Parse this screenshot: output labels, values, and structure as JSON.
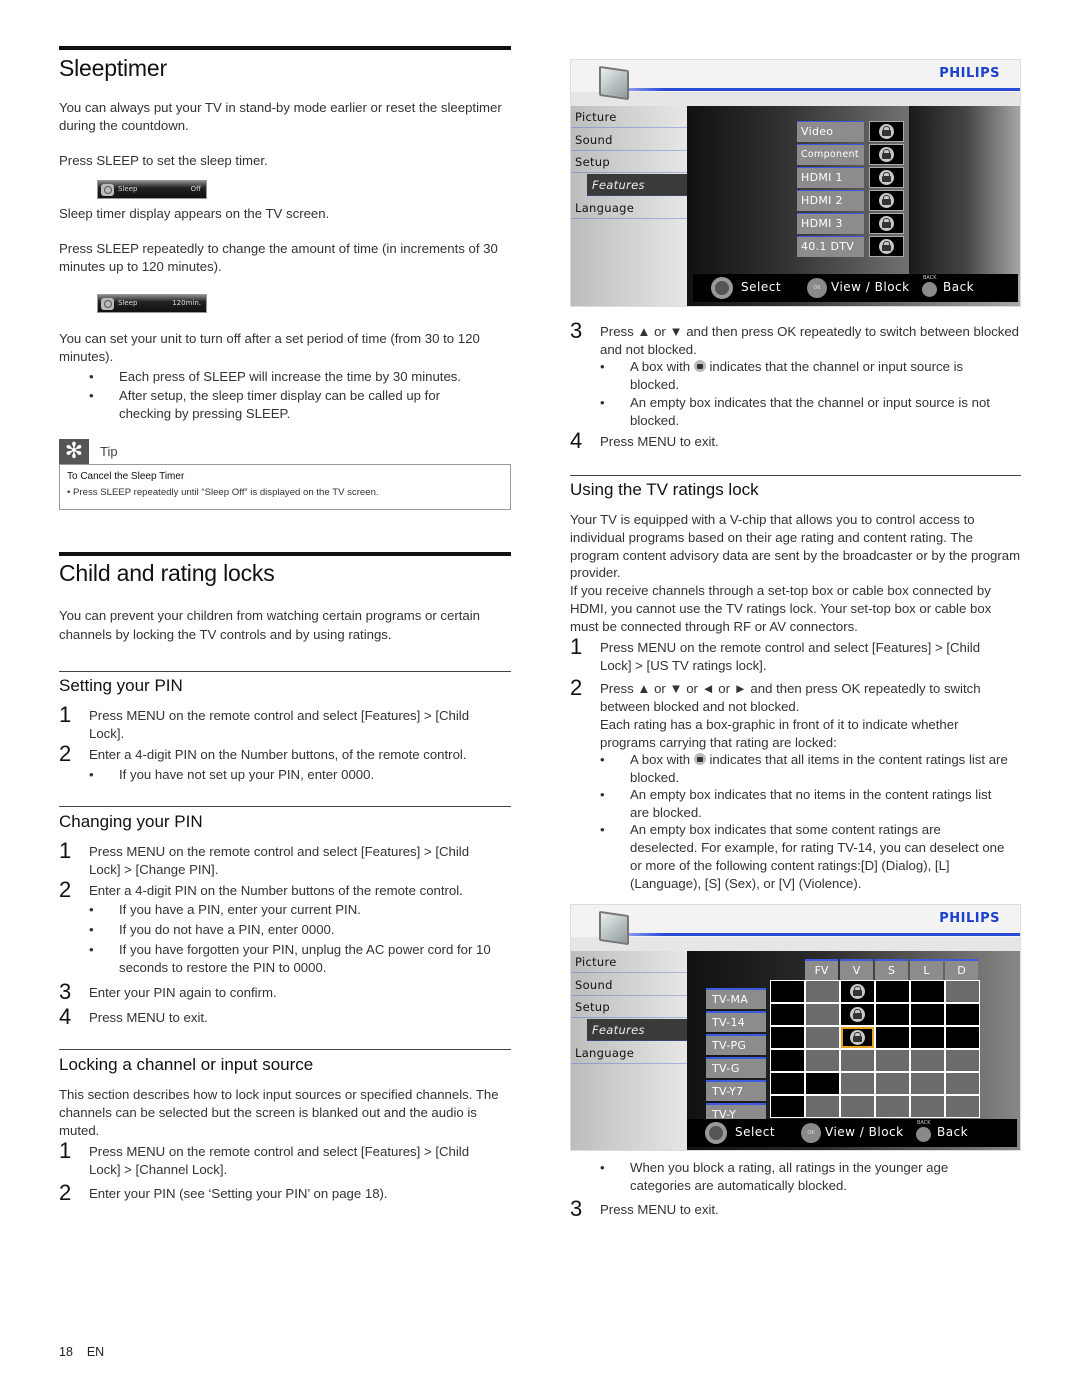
{
  "sleeptimer": {
    "title": "Sleeptimer",
    "intro": "You can always put your TV in stand-by mode earlier or reset the sleeptimer during the countdown.",
    "press_sleep": "Press SLEEP to set the sleep timer.",
    "osd1": {
      "label": "Sleep",
      "value": "Off"
    },
    "display_appears": "Sleep timer display appears on the TV screen.",
    "press_repeatedly": "Press SLEEP repeatedly to change the amount of time (in increments of 30 minutes up to 120 minutes).",
    "osd2": {
      "label": "Sleep",
      "value": "120min."
    },
    "set_unit": "You can set your unit to turn off after a set period of time (from 30 to 120 minutes).",
    "bullets": [
      "Each press of SLEEP will increase the time by 30 minutes.",
      "After setup, the sleep timer display can be called up for checking by pressing SLEEP."
    ],
    "tip": {
      "label": "Tip",
      "title": "To Cancel the Sleep Timer",
      "line": "• Press SLEEP repeatedly until “Sleep Off” is displayed on the TV screen."
    }
  },
  "child": {
    "title": "Child and rating locks",
    "intro": "You can prevent your children from watching certain programs or certain channels by locking the TV controls and by using ratings.",
    "setting_pin": {
      "title": "Setting your PIN",
      "steps": [
        {
          "n": "1",
          "text": "Press MENU on the remote control and select [Features] > [Child Lock]."
        },
        {
          "n": "2",
          "text": "Enter a 4-digit PIN on the Number buttons, of the remote control."
        }
      ],
      "bullets": [
        "If you have not set up your PIN, enter 0000."
      ]
    },
    "changing_pin": {
      "title": "Changing your PIN",
      "steps": [
        {
          "n": "1",
          "text": "Press MENU on the remote control and select [Features] > [Child Lock] > [Change PIN]."
        },
        {
          "n": "2",
          "text": "Enter a 4-digit PIN on the Number buttons of the remote control."
        },
        {
          "n": "3",
          "text": "Enter your PIN again to confirm."
        },
        {
          "n": "4",
          "text": "Press MENU to exit."
        }
      ],
      "bullets": [
        "If you have a PIN, enter your current PIN.",
        "If you do not have a PIN, enter 0000.",
        "If you have forgotten your PIN, unplug the AC power cord for 10 seconds to restore the PIN to 0000."
      ]
    },
    "locking": {
      "title": "Locking a channel or input source",
      "intro": "This section describes how to lock input sources or specified channels. The channels can be selected but the screen is blanked out and the audio is muted.",
      "steps": [
        {
          "n": "1",
          "text": "Press MENU on the remote control and select [Features] > [Child Lock] > [Channel Lock]."
        },
        {
          "n": "2",
          "text": "Enter your PIN (see ‘Setting your PIN’ on page 18)."
        },
        {
          "n": "3",
          "text": "Press ▲ or ▼ and then press OK repeatedly to switch between blocked and not blocked."
        },
        {
          "n": "4",
          "text": "Press MENU to exit."
        }
      ],
      "bullets": [
        {
          "pre": "A box with ",
          "post": " indicates that the channel or input source is blocked."
        },
        {
          "pre": "An empty box indicates that the channel or input source is not blocked.",
          "post": ""
        }
      ]
    },
    "ratings": {
      "title": "Using the TV ratings lock",
      "intro": "Your TV is equipped with a V-chip that allows you to control access to individual programs based on their age rating and content rating. The program content advisory data are sent by the broadcaster or by the program provider.",
      "intro2": "If you receive channels through a set-top box or cable box connected by HDMI, you cannot use the TV ratings lock. Your set-top box or cable box must be connected through RF or AV connectors.",
      "steps": [
        {
          "n": "1",
          "text": "Press MENU on the remote control and select [Features] > [Child Lock] > [US TV ratings lock]."
        },
        {
          "n": "2",
          "text": "Press ▲ or ▼ or ◄ or ► and then press OK repeatedly to switch between blocked and not blocked."
        },
        {
          "n": "3",
          "text": "Press MENU to exit."
        }
      ],
      "step2_extra": "Each rating has a box-graphic in front of it to indicate whether programs carrying that rating are locked:",
      "bullets": [
        {
          "pre": "A box with ",
          "post": " indicates that all items in the content ratings list are blocked."
        },
        {
          "pre": "An empty box indicates that no items in the content ratings list are blocked.",
          "post": ""
        },
        {
          "pre": "An empty box indicates that some content ratings are deselected. For example, for rating TV-14, you can deselect one or more of the following content ratings:[D] (Dialog), [L] (Language), [S] (Sex), or [V] (Violence).",
          "post": ""
        }
      ],
      "after_bullet": "When you block a rating, all ratings in the younger age categories are automatically blocked."
    }
  },
  "tv_menu_common": {
    "brand": "PHILIPS",
    "sidebar": [
      "Picture",
      "Sound",
      "Setup",
      "Features",
      "Language"
    ],
    "active_item": "Features",
    "footer": {
      "select": "Select",
      "ok": "OK",
      "view_block": "View / Block",
      "back_sup": "BACK",
      "back": "Back"
    }
  },
  "channel_lock_menu": {
    "sources": [
      {
        "name": "Video",
        "locked": true
      },
      {
        "name": "Component",
        "locked": true
      },
      {
        "name": "HDMI 1",
        "locked": true
      },
      {
        "name": "HDMI 2",
        "locked": true
      },
      {
        "name": "HDMI 3",
        "locked": true
      },
      {
        "name": "40.1 DTV",
        "locked": true
      }
    ]
  },
  "ratings_menu": {
    "columns": [
      "",
      "FV",
      "V",
      "S",
      "L",
      "D"
    ],
    "rows": [
      {
        "rating": "TV-MA",
        "cells": [
          "on",
          "off",
          "lock",
          "on",
          "on",
          "off"
        ]
      },
      {
        "rating": "TV-14",
        "cells": [
          "on",
          "off",
          "lock",
          "on",
          "on",
          "on"
        ]
      },
      {
        "rating": "TV-PG",
        "cells": [
          "on",
          "off",
          "lock-selected",
          "on",
          "on",
          "on"
        ]
      },
      {
        "rating": "TV-G",
        "cells": [
          "on",
          "off",
          "off",
          "off",
          "off",
          "off"
        ]
      },
      {
        "rating": "TV-Y7",
        "cells": [
          "on",
          "on",
          "off",
          "off",
          "off",
          "off"
        ]
      },
      {
        "rating": "TV-Y",
        "cells": [
          "on",
          "off",
          "off",
          "off",
          "off",
          "off"
        ]
      }
    ]
  },
  "page_footer": {
    "page": "18",
    "lang": "EN"
  }
}
